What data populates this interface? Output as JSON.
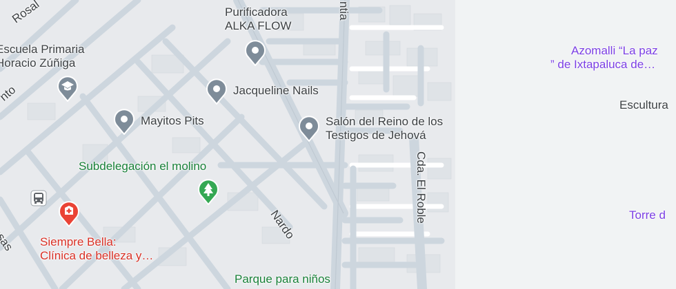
{
  "colors": {
    "background": "#f1f3f4",
    "block": "#e8eaed",
    "building": "#dfe3e7",
    "road_minor": "#ffffff",
    "road_major": "#cdd6de",
    "poi_pin": "#7e8c99",
    "health_pin": "#ea4335",
    "park_pin": "#34a853",
    "shopping_text": "#7b3fe4",
    "health_text": "#d93025",
    "park_text": "#188038"
  },
  "streets": [
    {
      "id": "rosal",
      "label": "Rosal"
    },
    {
      "id": "nto",
      "label": "nto"
    },
    {
      "id": "rosas",
      "label": "Rosas"
    },
    {
      "id": "ntia",
      "label": "ntia"
    },
    {
      "id": "cda-el-roble",
      "label": "Cda. El Roble"
    },
    {
      "id": "nardo",
      "label": "Nardo"
    }
  ],
  "places": [
    {
      "id": "purificadora",
      "name_line1": "Purificadora",
      "name_line2": "ALKA FLOW",
      "icon": "map-pin-icon"
    },
    {
      "id": "escuela",
      "name_line1": "Escuela Primaria",
      "name_line2": "Horacio Zúñiga",
      "icon": "school-pin-icon"
    },
    {
      "id": "jacqueline",
      "name": "Jacqueline Nails",
      "icon": "map-pin-icon"
    },
    {
      "id": "mayitos",
      "name": "Mayitos Pits",
      "icon": "map-pin-icon"
    },
    {
      "id": "salon",
      "name_line1": "Salón del Reino de los",
      "name_line2": "Testigos de Jehová",
      "icon": "map-pin-icon"
    },
    {
      "id": "subdelegacion",
      "name": "Subdelegación el molino",
      "icon": "tree-pin-icon"
    },
    {
      "id": "siempre-bella",
      "name_line1": "Siempre Bella:",
      "name_line2": "Clínica de belleza y…",
      "icon": "hospital-pin-icon"
    },
    {
      "id": "parque",
      "name": "Parque para niños",
      "icon": "park-pin-icon"
    },
    {
      "id": "azomalli",
      "name_line1": "Azomalli “La paz",
      "name_line2": "” de Ixtapaluca de…",
      "icon": "shopping-pin-icon"
    },
    {
      "id": "escultura",
      "name": "Escultura",
      "icon": "landmark-pin-icon"
    },
    {
      "id": "torre",
      "name": "Torre d",
      "icon": "landmark-pin-icon"
    }
  ],
  "transit": {
    "icon": "bus-stop-icon"
  }
}
